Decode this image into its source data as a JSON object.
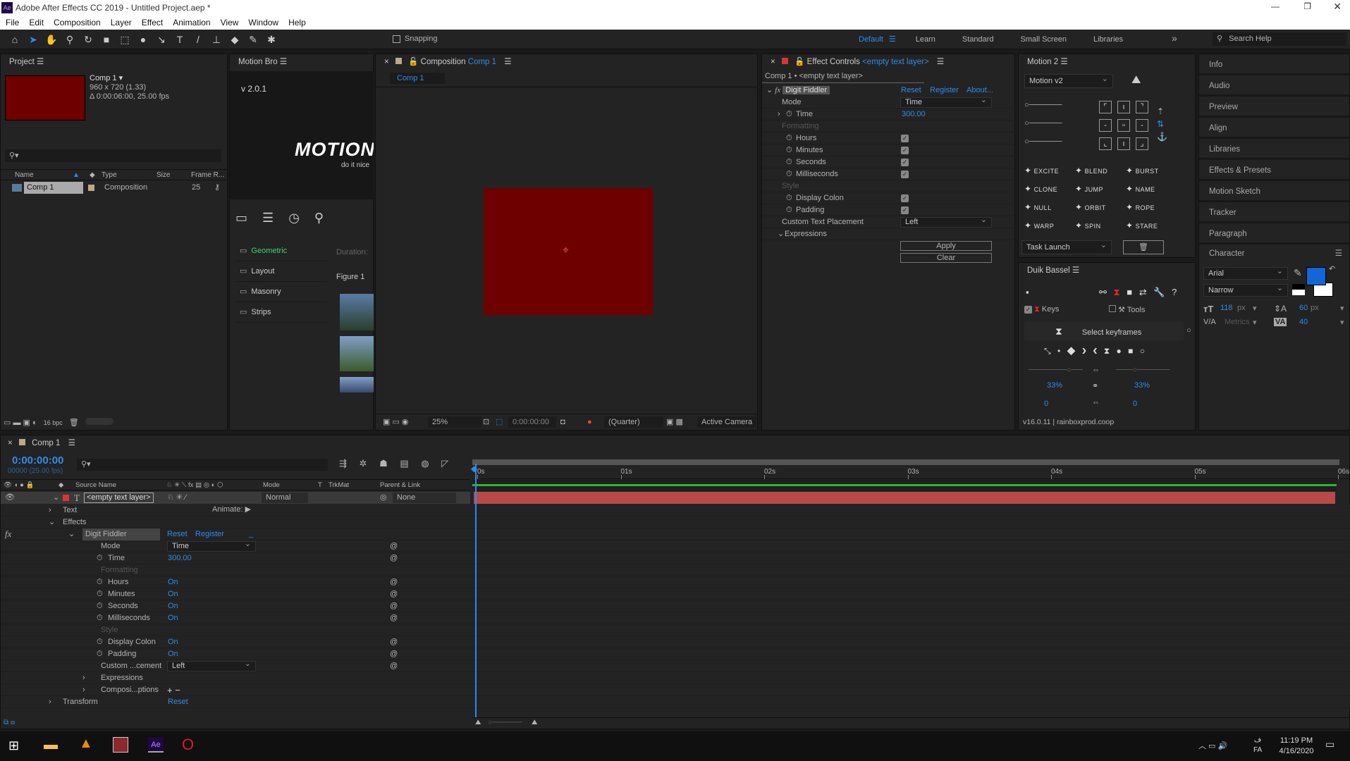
{
  "app": {
    "title": "Adobe After Effects CC 2019 - Untitled Project.aep *",
    "menu": [
      "File",
      "Edit",
      "Composition",
      "Layer",
      "Effect",
      "Animation",
      "View",
      "Window",
      "Help"
    ]
  },
  "toolbar": {
    "snapping": "Snapping",
    "workspaces": [
      "Default",
      "Learn",
      "Standard",
      "Small Screen",
      "Libraries"
    ],
    "search_placeholder": "Search Help"
  },
  "project": {
    "title": "Project",
    "comp_name": "Comp 1 ▾",
    "comp_size": "960 x 720 (1.33)",
    "comp_duration": "Δ 0:00:06:00, 25.00 fps",
    "columns": [
      "Name",
      "Type",
      "Size",
      "Frame R..."
    ],
    "items": [
      {
        "name": "Comp 1",
        "type": "Composition",
        "frame_rate": "25"
      }
    ],
    "bpc": "16 bpc",
    "thumb_color": "#6e0000"
  },
  "motionbro": {
    "title": "Motion Bro",
    "version": "v 2.0.1",
    "logo": "MOTION",
    "tagline": "do it nice",
    "categories": [
      "Geometric",
      "Layout",
      "Masonry",
      "Strips"
    ],
    "duration_label": "Duration:",
    "figure_label": "Figure 1"
  },
  "composition": {
    "title": "Composition",
    "comp": "Comp 1",
    "tab": "Comp 1",
    "zoom": "25%",
    "timecode": "0:00:00:00",
    "resolution": "(Quarter)",
    "camera": "Active Camera",
    "bg_color": "#6e0000"
  },
  "effect_controls": {
    "title": "Effect Controls",
    "layer": "<empty text layer>",
    "breadcrumb": "Comp 1 • <empty text layer>",
    "effect": "Digit Fiddler",
    "links": [
      "Reset",
      "Register",
      "About..."
    ],
    "rows": [
      {
        "label": "Mode",
        "type": "dropdown",
        "value": "Time"
      },
      {
        "label": "Time",
        "type": "value",
        "value": "300.00",
        "stopwatch": true,
        "twirl": true
      },
      {
        "label": "Formatting",
        "type": "section"
      },
      {
        "label": "Hours",
        "type": "check",
        "stopwatch": true
      },
      {
        "label": "Minutes",
        "type": "check",
        "stopwatch": true
      },
      {
        "label": "Seconds",
        "type": "check",
        "stopwatch": true
      },
      {
        "label": "Milliseconds",
        "type": "check",
        "stopwatch": true
      },
      {
        "label": "Style",
        "type": "section"
      },
      {
        "label": "Display Colon",
        "type": "check",
        "stopwatch": true
      },
      {
        "label": "Padding",
        "type": "check",
        "stopwatch": true
      },
      {
        "label": "Custom Text Placement",
        "type": "dropdown",
        "value": "Left"
      },
      {
        "label": "Expressions",
        "type": "group"
      }
    ],
    "apply": "Apply",
    "clear": "Clear"
  },
  "motion2": {
    "title": "Motion 2",
    "preset": "Motion v2",
    "buttons": [
      "EXCITE",
      "BLEND",
      "BURST",
      "CLONE",
      "JUMP",
      "NAME",
      "NULL",
      "ORBIT",
      "ROPE",
      "WARP",
      "SPIN",
      "STARE"
    ],
    "task": "Task Launch"
  },
  "duik": {
    "title": "Duik Bassel",
    "keys": "Keys",
    "tools": "Tools",
    "select": "Select keyframes",
    "influence_left": "33%",
    "influence_right": "33%",
    "speed_left": "0",
    "speed_right": "0",
    "version": "v16.0.11 | rainboxprod.coop"
  },
  "right_panels": [
    "Info",
    "Audio",
    "Preview",
    "Align",
    "Libraries",
    "Effects & Presets",
    "Motion Sketch",
    "Tracker",
    "Paragraph"
  ],
  "character": {
    "title": "Character",
    "font": "Arial",
    "style": "Narrow",
    "size": "118",
    "size_unit": "px",
    "leading": "60",
    "leading_unit": "px",
    "kerning": "Metrics",
    "tracking": "40",
    "fill_color": "#1565d8"
  },
  "timeline": {
    "tab": "Comp 1",
    "timecode": "0:00:00:00",
    "frames": "00000 (25.00 fps)",
    "columns": [
      "Source Name",
      "Mode",
      "T",
      "TrkMat",
      "Parent & Link"
    ],
    "layer": {
      "name": "<empty text layer>",
      "mode": "Normal",
      "parent": "None"
    },
    "animate": "Animate:",
    "effect_links": [
      "Reset",
      "Register",
      "_"
    ],
    "ruler": [
      "0s",
      "01s",
      "02s",
      "03s",
      "04s",
      "05s",
      "06s"
    ],
    "rows": [
      {
        "label": "Text",
        "indent": 0,
        "twirl": "›"
      },
      {
        "label": "Effects",
        "indent": 0,
        "twirl": "⌄"
      },
      {
        "label": "Digit Fiddler",
        "indent": 1,
        "twirl": "⌄",
        "effect": true
      },
      {
        "label": "Mode",
        "indent": 2,
        "dropdown": "Time"
      },
      {
        "label": "Time",
        "indent": 2,
        "sw": true,
        "value": "300.00"
      },
      {
        "label": "Formatting",
        "indent": 2,
        "dim": true
      },
      {
        "label": "Hours",
        "indent": 2,
        "sw": true,
        "value": "On"
      },
      {
        "label": "Minutes",
        "indent": 2,
        "sw": true,
        "value": "On"
      },
      {
        "label": "Seconds",
        "indent": 2,
        "sw": true,
        "value": "On"
      },
      {
        "label": "Milliseconds",
        "indent": 2,
        "sw": true,
        "value": "On"
      },
      {
        "label": "Style",
        "indent": 2,
        "dim": true
      },
      {
        "label": "Display Colon",
        "indent": 2,
        "sw": true,
        "value": "On"
      },
      {
        "label": "Padding",
        "indent": 2,
        "sw": true,
        "value": "On"
      },
      {
        "label": "Custom ...cement",
        "indent": 2,
        "dropdown": "Left"
      },
      {
        "label": "Expressions",
        "indent": 2,
        "twirl": "›"
      },
      {
        "label": "Composi...ptions",
        "indent": 2,
        "twirl": "›",
        "plusminus": "+ −"
      },
      {
        "label": "Transform",
        "indent": 0,
        "twirl": "›",
        "value": "Reset"
      }
    ]
  },
  "taskbar": {
    "time": "11:19 PM",
    "date": "4/16/2020",
    "lang": "FA"
  }
}
